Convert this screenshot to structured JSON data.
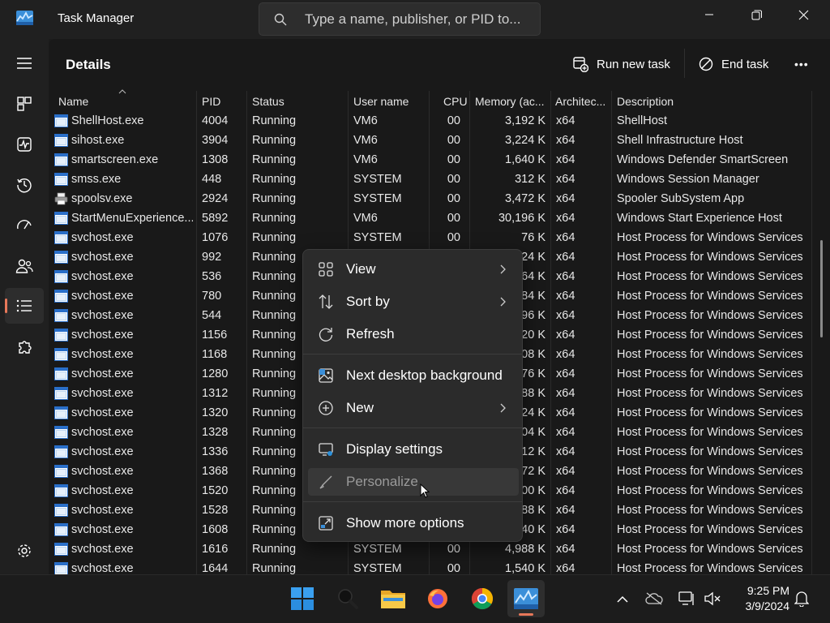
{
  "window": {
    "title": "Task Manager",
    "search_placeholder": "Type a name, publisher, or PID to..."
  },
  "page": {
    "title": "Details",
    "run_new_task": "Run new task",
    "end_task": "End task",
    "more": "•••"
  },
  "columns": [
    "Name",
    "PID",
    "Status",
    "User name",
    "CPU",
    "Memory (ac...",
    "Architec...",
    "Description"
  ],
  "processes": [
    {
      "name": "ShellHost.exe",
      "pid": "4004",
      "status": "Running",
      "user": "VM6",
      "cpu": "00",
      "memory": "3,192 K",
      "arch": "x64",
      "description": "ShellHost",
      "icon": "window-icon"
    },
    {
      "name": "sihost.exe",
      "pid": "3904",
      "status": "Running",
      "user": "VM6",
      "cpu": "00",
      "memory": "3,224 K",
      "arch": "x64",
      "description": "Shell Infrastructure Host",
      "icon": "window-icon"
    },
    {
      "name": "smartscreen.exe",
      "pid": "1308",
      "status": "Running",
      "user": "VM6",
      "cpu": "00",
      "memory": "1,640 K",
      "arch": "x64",
      "description": "Windows Defender SmartScreen",
      "icon": "window-icon"
    },
    {
      "name": "smss.exe",
      "pid": "448",
      "status": "Running",
      "user": "SYSTEM",
      "cpu": "00",
      "memory": "312 K",
      "arch": "x64",
      "description": "Windows Session Manager",
      "icon": "window-icon"
    },
    {
      "name": "spoolsv.exe",
      "pid": "2924",
      "status": "Running",
      "user": "SYSTEM",
      "cpu": "00",
      "memory": "3,472 K",
      "arch": "x64",
      "description": "Spooler SubSystem App",
      "icon": "printer-icon"
    },
    {
      "name": "StartMenuExperience...",
      "pid": "5892",
      "status": "Running",
      "user": "VM6",
      "cpu": "00",
      "memory": "30,196 K",
      "arch": "x64",
      "description": "Windows Start Experience Host",
      "icon": "window-icon"
    },
    {
      "name": "svchost.exe",
      "pid": "1076",
      "status": "Running",
      "user": "SYSTEM",
      "cpu": "00",
      "memory": "76 K",
      "arch": "x64",
      "description": "Host Process for Windows Services",
      "icon": "window-icon"
    },
    {
      "name": "svchost.exe",
      "pid": "992",
      "status": "Running",
      "user": "",
      "cpu": "",
      "memory": "24 K",
      "arch": "x64",
      "description": "Host Process for Windows Services",
      "icon": "window-icon"
    },
    {
      "name": "svchost.exe",
      "pid": "536",
      "status": "Running",
      "user": "",
      "cpu": "",
      "memory": "64 K",
      "arch": "x64",
      "description": "Host Process for Windows Services",
      "icon": "window-icon"
    },
    {
      "name": "svchost.exe",
      "pid": "780",
      "status": "Running",
      "user": "",
      "cpu": "",
      "memory": "84 K",
      "arch": "x64",
      "description": "Host Process for Windows Services",
      "icon": "window-icon"
    },
    {
      "name": "svchost.exe",
      "pid": "544",
      "status": "Running",
      "user": "",
      "cpu": "",
      "memory": "96 K",
      "arch": "x64",
      "description": "Host Process for Windows Services",
      "icon": "window-icon"
    },
    {
      "name": "svchost.exe",
      "pid": "1156",
      "status": "Running",
      "user": "",
      "cpu": "",
      "memory": "20 K",
      "arch": "x64",
      "description": "Host Process for Windows Services",
      "icon": "window-icon"
    },
    {
      "name": "svchost.exe",
      "pid": "1168",
      "status": "Running",
      "user": "",
      "cpu": "",
      "memory": "08 K",
      "arch": "x64",
      "description": "Host Process for Windows Services",
      "icon": "window-icon"
    },
    {
      "name": "svchost.exe",
      "pid": "1280",
      "status": "Running",
      "user": "",
      "cpu": "",
      "memory": "76 K",
      "arch": "x64",
      "description": "Host Process for Windows Services",
      "icon": "window-icon"
    },
    {
      "name": "svchost.exe",
      "pid": "1312",
      "status": "Running",
      "user": "",
      "cpu": "",
      "memory": "88 K",
      "arch": "x64",
      "description": "Host Process for Windows Services",
      "icon": "window-icon"
    },
    {
      "name": "svchost.exe",
      "pid": "1320",
      "status": "Running",
      "user": "",
      "cpu": "",
      "memory": "24 K",
      "arch": "x64",
      "description": "Host Process for Windows Services",
      "icon": "window-icon"
    },
    {
      "name": "svchost.exe",
      "pid": "1328",
      "status": "Running",
      "user": "",
      "cpu": "",
      "memory": "04 K",
      "arch": "x64",
      "description": "Host Process for Windows Services",
      "icon": "window-icon"
    },
    {
      "name": "svchost.exe",
      "pid": "1336",
      "status": "Running",
      "user": "",
      "cpu": "",
      "memory": "12 K",
      "arch": "x64",
      "description": "Host Process for Windows Services",
      "icon": "window-icon"
    },
    {
      "name": "svchost.exe",
      "pid": "1368",
      "status": "Running",
      "user": "",
      "cpu": "",
      "memory": "72 K",
      "arch": "x64",
      "description": "Host Process for Windows Services",
      "icon": "window-icon"
    },
    {
      "name": "svchost.exe",
      "pid": "1520",
      "status": "Running",
      "user": "",
      "cpu": "",
      "memory": "00 K",
      "arch": "x64",
      "description": "Host Process for Windows Services",
      "icon": "window-icon"
    },
    {
      "name": "svchost.exe",
      "pid": "1528",
      "status": "Running",
      "user": "",
      "cpu": "",
      "memory": "88 K",
      "arch": "x64",
      "description": "Host Process for Windows Services",
      "icon": "window-icon"
    },
    {
      "name": "svchost.exe",
      "pid": "1608",
      "status": "Running",
      "user": "",
      "cpu": "",
      "memory": "40 K",
      "arch": "x64",
      "description": "Host Process for Windows Services",
      "icon": "window-icon"
    },
    {
      "name": "svchost.exe",
      "pid": "1616",
      "status": "Running",
      "user": "SYSTEM",
      "cpu": "00",
      "memory": "4,988 K",
      "arch": "x64",
      "description": "Host Process for Windows Services",
      "icon": "window-icon"
    },
    {
      "name": "svchost.exe",
      "pid": "1644",
      "status": "Running",
      "user": "SYSTEM",
      "cpu": "00",
      "memory": "1,540 K",
      "arch": "x64",
      "description": "Host Process for Windows Services",
      "icon": "window-icon"
    }
  ],
  "context_menu": {
    "view": "View",
    "sort_by": "Sort by",
    "refresh": "Refresh",
    "next_background": "Next desktop background",
    "new": "New",
    "display_settings": "Display settings",
    "personalize": "Personalize",
    "show_more": "Show more options"
  },
  "taskbar": {
    "time": "9:25 PM",
    "date": "3/9/2024"
  },
  "colors": {
    "accent": "#e8785a",
    "background": "#191919",
    "menu": "#2b2b2b"
  }
}
